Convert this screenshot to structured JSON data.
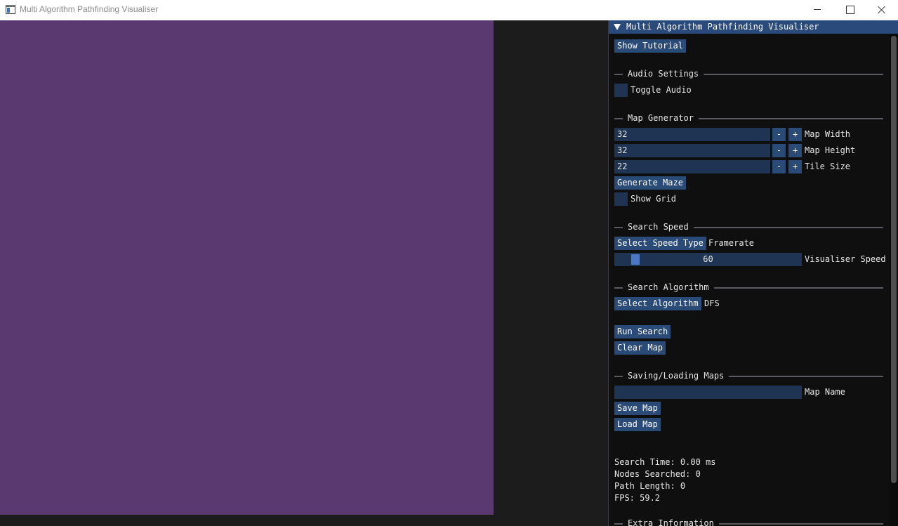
{
  "window": {
    "title": "Multi Algorithm Pathfinding Visualiser"
  },
  "panel": {
    "title": "Multi Algorithm Pathfinding Visualiser",
    "show_tutorial": "Show Tutorial",
    "audio": {
      "header": "Audio Settings",
      "toggle_label": "Toggle Audio",
      "toggle_checked": false
    },
    "map_generator": {
      "header": "Map Generator",
      "fields": [
        {
          "value": "32",
          "label": "Map Width"
        },
        {
          "value": "32",
          "label": "Map Height"
        },
        {
          "value": "22",
          "label": "Tile Size"
        }
      ],
      "minus": "-",
      "plus": "+",
      "generate_maze": "Generate Maze",
      "show_grid_label": "Show Grid",
      "show_grid_checked": false
    },
    "search_speed": {
      "header": "Search Speed",
      "select_button": "Select Speed Type",
      "selected": "Framerate",
      "slider_value": "60",
      "slider_label": "Visualiser Speed"
    },
    "search_algorithm": {
      "header": "Search Algorithm",
      "select_button": "Select Algorithm",
      "selected": "DFS"
    },
    "run_search": "Run Search",
    "clear_map": "Clear Map",
    "saving": {
      "header": "Saving/Loading Maps",
      "map_name_value": "",
      "map_name_label": "Map Name",
      "save_map": "Save Map",
      "load_map": "Load Map"
    },
    "stats": {
      "search_time": "Search Time: 0.00 ms",
      "nodes_searched": "Nodes Searched: 0",
      "path_length": "Path Length: 0",
      "fps": "FPS: 59.2"
    },
    "extra_header": "Extra Information"
  }
}
